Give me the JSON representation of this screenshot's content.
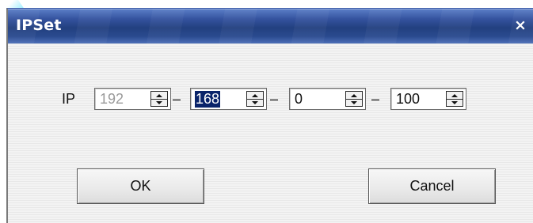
{
  "window": {
    "title": "IPSet",
    "close_glyph": "×"
  },
  "ip_field": {
    "label": "IP",
    "separator": "–",
    "octets": [
      {
        "value": "192",
        "state": "disabled"
      },
      {
        "value": "168",
        "state": "selected"
      },
      {
        "value": "0",
        "state": "normal"
      },
      {
        "value": "100",
        "state": "normal"
      }
    ]
  },
  "buttons": {
    "ok_label": "OK",
    "cancel_label": "Cancel"
  },
  "colors": {
    "titlebar": "#22407f",
    "selection": "#0a246a"
  },
  "icons": [
    "close-icon",
    "spin-up-icon",
    "spin-down-icon"
  ]
}
